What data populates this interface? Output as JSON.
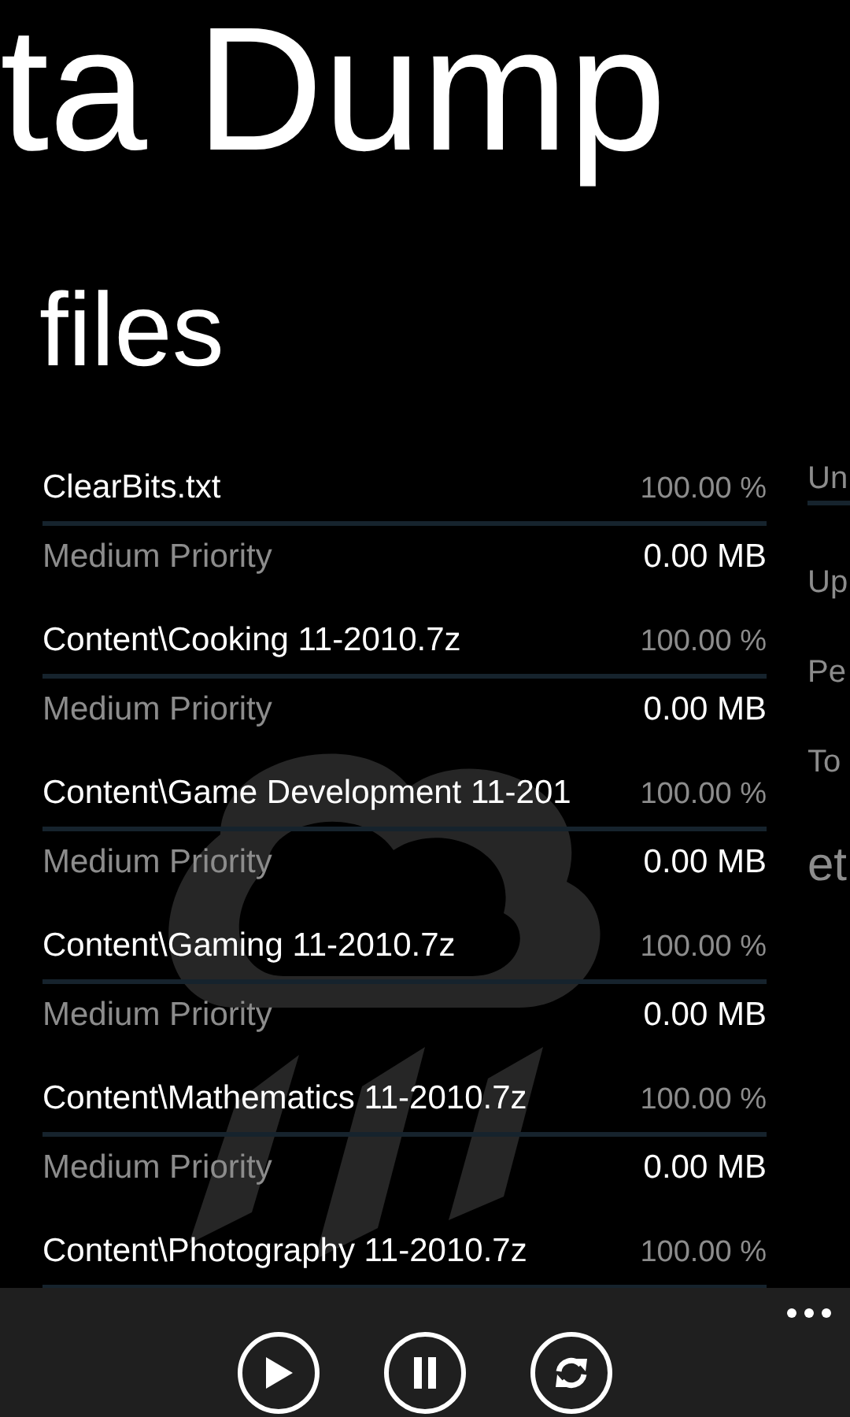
{
  "panorama": {
    "title": "ta Dump"
  },
  "files_section": {
    "header": "files",
    "files": [
      {
        "name": "ClearBits.txt",
        "percent": "100.00 %",
        "level": 1,
        "priority": "Medium Priority",
        "size": "0.00 MB"
      },
      {
        "name": "Content\\Cooking 11-2010.7z",
        "percent": "100.00 %",
        "level": 1,
        "priority": "Medium Priority",
        "size": "0.00 MB"
      },
      {
        "name": "Content\\Game Development 11-201",
        "percent": "100.00 %",
        "level": 1,
        "priority": "Medium Priority",
        "size": "0.00 MB"
      },
      {
        "name": "Content\\Gaming 11-2010.7z",
        "percent": "100.00 %",
        "level": 1,
        "priority": "Medium Priority",
        "size": "0.00 MB"
      },
      {
        "name": "Content\\Mathematics 11-2010.7z",
        "percent": "100.00 %",
        "level": 1,
        "priority": "Medium Priority",
        "size": "0.00 MB"
      },
      {
        "name": "Content\\Photography 11-2010.7z",
        "percent": "100.00 %",
        "level": 1
      }
    ]
  },
  "next_section": {
    "items": [
      {
        "kind": "label",
        "text": "Un"
      },
      {
        "kind": "label",
        "text": "Up"
      },
      {
        "kind": "label",
        "text": "Pe"
      },
      {
        "kind": "label",
        "text": "To"
      },
      {
        "kind": "heading",
        "text": "et"
      }
    ]
  },
  "app_bar": {
    "buttons": [
      {
        "kind": "play"
      },
      {
        "kind": "pause"
      },
      {
        "kind": "refresh"
      }
    ],
    "more_menu": true
  }
}
